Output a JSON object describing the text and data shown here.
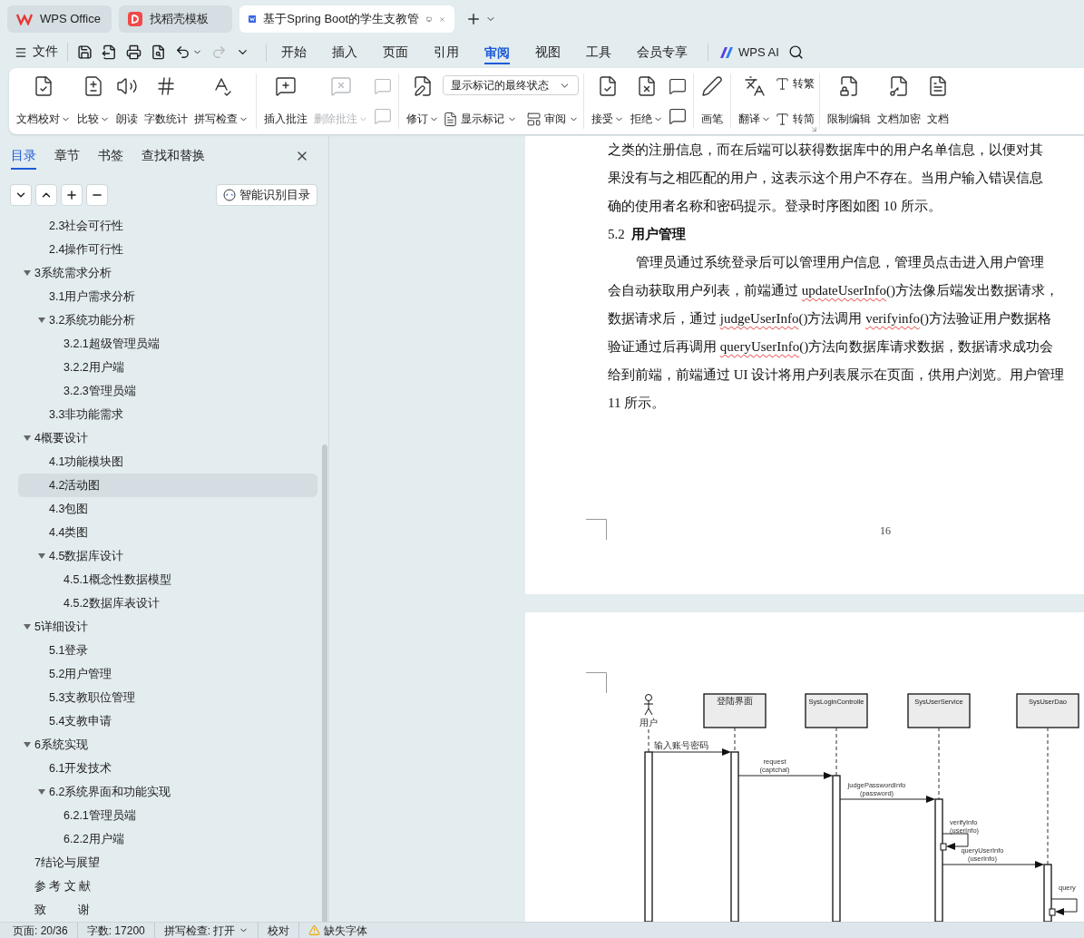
{
  "tabs": [
    {
      "label": "WPS Office",
      "kind": "wps",
      "selected": false
    },
    {
      "label": "找稻壳模板",
      "kind": "docer",
      "selected": false
    },
    {
      "label": "基于Spring Boot的学生支教管",
      "kind": "doc",
      "selected": true
    }
  ],
  "menu": {
    "file": "文件",
    "tabs": [
      {
        "label": "开始",
        "selected": false
      },
      {
        "label": "插入",
        "selected": false
      },
      {
        "label": "页面",
        "selected": false
      },
      {
        "label": "引用",
        "selected": false
      },
      {
        "label": "审阅",
        "selected": true
      },
      {
        "label": "视图",
        "selected": false
      },
      {
        "label": "工具",
        "selected": false
      },
      {
        "label": "会员专享",
        "selected": false
      }
    ],
    "ai": "WPS AI"
  },
  "ribbon": {
    "groups": [
      {
        "launcher": false,
        "items": [
          {
            "kind": "large",
            "label": "文档校对",
            "dropdown": true,
            "disabled": false
          },
          {
            "kind": "large",
            "label": "比较",
            "dropdown": true,
            "disabled": false
          },
          {
            "kind": "large",
            "label": "朗读",
            "dropdown": false,
            "disabled": false
          },
          {
            "kind": "large",
            "label": "字数统计",
            "dropdown": false,
            "disabled": false
          },
          {
            "kind": "large",
            "label": "拼写检查",
            "dropdown": true,
            "disabled": false
          }
        ]
      },
      {
        "launcher": false,
        "items": [
          {
            "kind": "large",
            "label": "插入批注",
            "dropdown": false,
            "disabled": false
          },
          {
            "kind": "large",
            "label": "删除批注",
            "dropdown": true,
            "disabled": true
          },
          {
            "kind": "stack",
            "rows": [
              [
                {
                  "kind": "icon",
                  "disabled": true
                }
              ],
              [
                {
                  "kind": "icon",
                  "disabled": true
                }
              ]
            ]
          }
        ]
      },
      {
        "launcher": false,
        "items": [
          {
            "kind": "large",
            "label": "修订",
            "dropdown": true,
            "disabled": false
          },
          {
            "kind": "stack",
            "rows": [
              [
                {
                  "kind": "select",
                  "value": "显示标记的最终状态"
                }
              ],
              [
                {
                  "kind": "small",
                  "label": "显示标记",
                  "dropdown": true
                },
                {
                  "kind": "small",
                  "label": "审阅",
                  "dropdown": true
                }
              ]
            ]
          }
        ]
      },
      {
        "launcher": false,
        "items": [
          {
            "kind": "large",
            "label": "接受",
            "dropdown": true,
            "disabled": false
          },
          {
            "kind": "large",
            "label": "拒绝",
            "dropdown": true,
            "disabled": false
          },
          {
            "kind": "stack",
            "rows": [
              [
                {
                  "kind": "icon",
                  "disabled": false
                }
              ],
              [
                {
                  "kind": "icon",
                  "disabled": false
                }
              ]
            ]
          }
        ]
      },
      {
        "launcher": false,
        "items": [
          {
            "kind": "large",
            "label": "画笔",
            "dropdown": false,
            "disabled": false
          }
        ]
      },
      {
        "launcher": true,
        "items": [
          {
            "kind": "large",
            "label": "翻译",
            "dropdown": true,
            "disabled": false
          },
          {
            "kind": "stack",
            "rows": [
              [
                {
                  "kind": "small",
                  "label": "转繁",
                  "dropdown": false
                }
              ],
              [
                {
                  "kind": "small",
                  "label": "转简",
                  "dropdown": false
                }
              ]
            ]
          }
        ]
      },
      {
        "launcher": false,
        "items": [
          {
            "kind": "large",
            "label": "限制编辑",
            "dropdown": false,
            "disabled": false
          },
          {
            "kind": "large",
            "label": "文档加密",
            "dropdown": false,
            "disabled": false
          },
          {
            "kind": "large",
            "label": "文档",
            "dropdown": false,
            "disabled": false
          }
        ]
      }
    ]
  },
  "sidebar": {
    "tabs": [
      {
        "label": "目录",
        "selected": true
      },
      {
        "label": "章节",
        "selected": false
      },
      {
        "label": "书签",
        "selected": false
      },
      {
        "label": "查找和替换",
        "selected": false
      }
    ],
    "smart_button": "智能识别目录",
    "toc": [
      {
        "children": [
          {
            "label": "2.3社会可行性",
            "selected": false
          },
          {
            "label": "2.4操作可行性",
            "selected": false
          }
        ]
      },
      {
        "label": "3系统需求分析",
        "expanded": true,
        "selected": false,
        "children": [
          {
            "label": "3.1用户需求分析",
            "selected": false
          },
          {
            "label": "3.2系统功能分析",
            "expanded": true,
            "selected": false,
            "children": [
              {
                "label": "3.2.1超级管理员端",
                "selected": false
              },
              {
                "label": "3.2.2用户端",
                "selected": false
              },
              {
                "label": "3.2.3管理员端",
                "selected": false
              }
            ]
          },
          {
            "label": "3.3非功能需求",
            "selected": false
          }
        ]
      },
      {
        "label": "4概要设计",
        "expanded": true,
        "selected": false,
        "children": [
          {
            "label": "4.1功能模块图",
            "selected": false
          },
          {
            "label": "4.2活动图",
            "selected": true
          },
          {
            "label": "4.3包图",
            "selected": false
          },
          {
            "label": "4.4类图",
            "selected": false
          },
          {
            "label": "4.5数据库设计",
            "expanded": true,
            "selected": false,
            "children": [
              {
                "label": "4.5.1概念性数据模型",
                "selected": false
              },
              {
                "label": "4.5.2数据库表设计",
                "selected": false
              }
            ]
          }
        ]
      },
      {
        "label": "5详细设计",
        "expanded": true,
        "selected": false,
        "children": [
          {
            "label": "5.1登录",
            "selected": false
          },
          {
            "label": "5.2用户管理",
            "selected": false
          },
          {
            "label": "5.3支教职位管理",
            "selected": false
          },
          {
            "label": "5.4支教申请",
            "selected": false
          }
        ]
      },
      {
        "label": "6系统实现",
        "expanded": true,
        "selected": false,
        "children": [
          {
            "label": "6.1开发技术",
            "selected": false
          },
          {
            "label": "6.2系统界面和功能实现",
            "expanded": true,
            "selected": false,
            "children": [
              {
                "label": "6.2.1管理员端",
                "selected": false
              },
              {
                "label": "6.2.2用户端",
                "selected": false
              }
            ]
          }
        ]
      },
      {
        "label": "7结论与展望",
        "selected": false
      },
      {
        "label": "参 考 文 献",
        "selected": false
      },
      {
        "label": "致          谢",
        "selected": false
      }
    ]
  },
  "document": {
    "page1": {
      "page_number": "16",
      "blocks": [
        {
          "kind": "line",
          "segments": [
            {
              "text": "之类的注册信息，而在后端可以获得数据库中的用户名单信息，以便对其",
              "flagged": false
            }
          ]
        },
        {
          "kind": "line",
          "segments": [
            {
              "text": "果没有与之相匹配的用户，这表示这个用户不存在。当用户输入错误信息",
              "flagged": false
            }
          ]
        },
        {
          "kind": "line",
          "segments": [
            {
              "text": "确的使用者名称和密码提示。登录时序图如图 10 所示。",
              "flagged": false
            }
          ]
        },
        {
          "kind": "heading",
          "text": "5.2  **用户管理**"
        },
        {
          "kind": "indent",
          "segments": [
            {
              "text": "管理员通过系统登录后可以管理用户信息，管理员点击进入用户管理",
              "flagged": false
            }
          ]
        },
        {
          "kind": "line",
          "segments": [
            {
              "text": "会自动获取用户列表，前端通过 ",
              "flagged": false
            },
            {
              "text": "updateUserInfo",
              "flagged": true
            },
            {
              "text": "()方法像后端发出数据请求，",
              "flagged": false
            }
          ]
        },
        {
          "kind": "line",
          "segments": [
            {
              "text": "数据请求后，通过 ",
              "flagged": false
            },
            {
              "text": "judgeUserInfo",
              "flagged": true
            },
            {
              "text": "()方法调用 ",
              "flagged": false
            },
            {
              "text": "verifyinfo",
              "flagged": true
            },
            {
              "text": "()方法验证用户数据格",
              "flagged": false
            }
          ]
        },
        {
          "kind": "line",
          "segments": [
            {
              "text": "验证通过后再调用 ",
              "flagged": false
            },
            {
              "text": "queryUserInfo",
              "flagged": true
            },
            {
              "text": "()方法向数据库请求数据，数据请求成功会",
              "flagged": false
            }
          ]
        },
        {
          "kind": "line",
          "segments": [
            {
              "text": "给到前端，前端通过 UI 设计将用户列表展示在页面，供用户浏览。用户管理",
              "flagged": false
            }
          ]
        },
        {
          "kind": "line",
          "segments": [
            {
              "text": "11 所示。",
              "flagged": false
            }
          ]
        }
      ]
    },
    "diagram": {
      "participants": [
        {
          "label": "用户",
          "kind": "actor"
        },
        {
          "label": "登陆界面",
          "kind": "object"
        },
        {
          "label": "SysLoginControlle",
          "kind": "object"
        },
        {
          "label": "SysUserService",
          "kind": "object"
        },
        {
          "label": "SysUserDao",
          "kind": "object"
        }
      ],
      "messages": [
        {
          "kind": "call",
          "lines": [
            "输入账号密码"
          ]
        },
        {
          "kind": "call",
          "lines": [
            "request",
            "(captchal)"
          ]
        },
        {
          "kind": "call",
          "lines": [
            "judgePasswordInfo",
            "(password)"
          ]
        },
        {
          "kind": "self",
          "lines": [
            "verifyInfo",
            "(userInfo)"
          ]
        },
        {
          "kind": "call",
          "lines": [
            "queryUserInfo",
            "(userInfo)"
          ]
        },
        {
          "kind": "self",
          "lines": [
            "query"
          ]
        }
      ]
    }
  },
  "status_bar": [
    {
      "label": "页面: 20/36",
      "kind": "text"
    },
    {
      "label": "字数: 17200",
      "kind": "text"
    },
    {
      "label": "拼写检查: 打开",
      "kind": "dropdown"
    },
    {
      "label": "校对",
      "kind": "text"
    },
    {
      "label": "缺失字体",
      "kind": "warning"
    }
  ]
}
